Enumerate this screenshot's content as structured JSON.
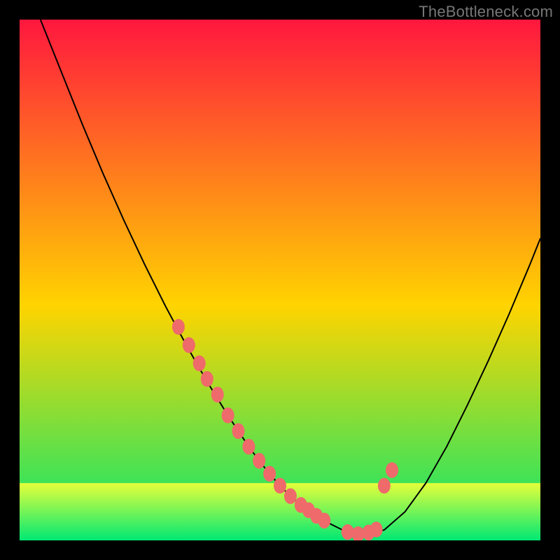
{
  "watermark": "TheBottleneck.com",
  "chart_data": {
    "type": "line",
    "title": "",
    "xlabel": "",
    "ylabel": "",
    "xlim": [
      0,
      100
    ],
    "ylim": [
      0,
      100
    ],
    "grid": false,
    "legend": false,
    "background_gradient": {
      "top_color": "#ff173e",
      "mid_color": "#ffd400",
      "bottom_color": "#00e874"
    },
    "series": [
      {
        "name": "bottleneck-curve",
        "stroke": "#000000",
        "x": [
          4,
          8,
          12,
          16,
          20,
          24,
          28,
          32,
          36,
          40,
          44,
          46,
          48,
          50,
          52,
          54,
          56,
          58,
          62,
          66,
          70,
          74,
          78,
          82,
          86,
          90,
          94,
          98,
          100
        ],
        "y": [
          100,
          90,
          80,
          70.5,
          61.5,
          53,
          45,
          37.5,
          30.5,
          24,
          18,
          15.3,
          12.8,
          10.5,
          8.5,
          6.8,
          5.2,
          4,
          2,
          1,
          2,
          5.5,
          11,
          18,
          26,
          34.5,
          43.5,
          53,
          58
        ]
      }
    ],
    "highlight_points": {
      "name": "pink-dots",
      "color": "#ef6a6a",
      "radius_px": 9,
      "x": [
        30.5,
        32.5,
        34.5,
        36,
        38,
        40,
        42,
        44,
        46,
        48,
        50,
        52,
        54,
        55.5,
        57,
        58.5,
        63,
        65,
        67,
        68.5,
        70,
        71.5
      ],
      "y": [
        41,
        37.5,
        34,
        31,
        28,
        24,
        21,
        18,
        15.3,
        12.8,
        10.5,
        8.5,
        6.8,
        5.8,
        4.7,
        3.8,
        1.6,
        1.2,
        1.5,
        2.1,
        10.5,
        13.5
      ]
    },
    "green_band": {
      "y_top": 11,
      "y_bottom": 0,
      "gradient_top": "#e6ff3a",
      "gradient_bottom": "#00e874"
    }
  }
}
